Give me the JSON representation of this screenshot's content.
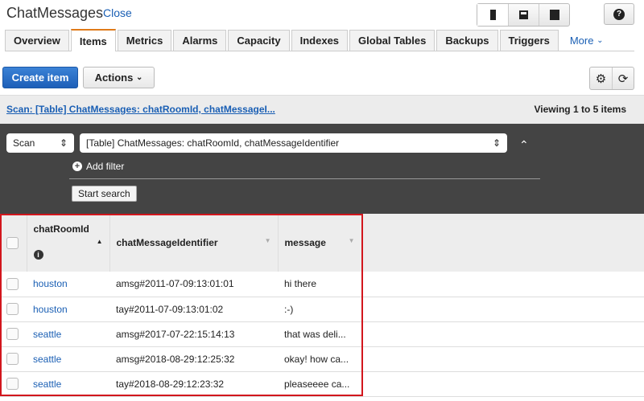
{
  "header": {
    "title": "ChatMessages",
    "close": "Close"
  },
  "tabs": [
    "Overview",
    "Items",
    "Metrics",
    "Alarms",
    "Capacity",
    "Indexes",
    "Global Tables",
    "Backups",
    "Triggers"
  ],
  "more": "More",
  "toolbar": {
    "create": "Create item",
    "actions": "Actions"
  },
  "scan": {
    "link": "Scan: [Table] ChatMessages: chatRoomId, chatMessageI...",
    "viewing": "Viewing 1 to 5 items",
    "mode": "Scan",
    "table": "[Table] ChatMessages: chatRoomId, chatMessageIdentifier",
    "add_filter": "Add filter",
    "start": "Start search"
  },
  "columns": [
    "chatRoomId",
    "chatMessageIdentifier",
    "message"
  ],
  "rows": [
    [
      "houston",
      "amsg#2011-07-09:13:01:01",
      "hi there"
    ],
    [
      "houston",
      "tay#2011-07-09:13:01:02",
      ":-)"
    ],
    [
      "seattle",
      "amsg#2017-07-22:15:14:13",
      "that was deli..."
    ],
    [
      "seattle",
      "amsg#2018-08-29:12:25:32",
      "okay! how ca..."
    ],
    [
      "seattle",
      "tay#2018-08-29:12:23:32",
      "pleaseeee ca..."
    ]
  ]
}
